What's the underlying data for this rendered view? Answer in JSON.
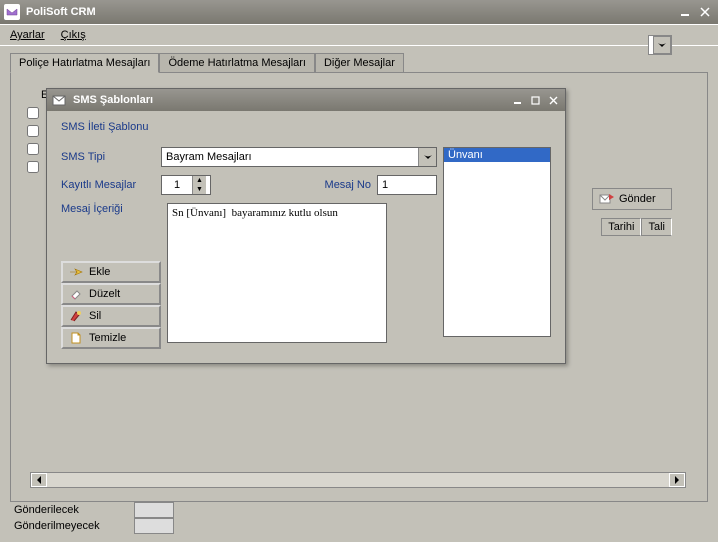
{
  "window": {
    "title": "PoliSoft CRM"
  },
  "menu": {
    "ayarlar": "Ayarlar",
    "cikis": "Çıkış"
  },
  "tabs": {
    "police": "Poliçe Hatırlatma Mesajları",
    "odeme": "Ödeme Hatırlatma Mesajları",
    "diger": "Diğer Mesajlar"
  },
  "bg": {
    "c1": "",
    "c2": "E"
  },
  "gonder": "Gönder",
  "table": {
    "col1": "Tarihi",
    "col2": "Tali"
  },
  "status": {
    "gonderilecek": "Gönderilecek",
    "gonderilmeyecek": "Gönderilmeyecek"
  },
  "dialog": {
    "title": "SMS Şablonları",
    "group": "SMS İleti Şablonu",
    "sms_tipi_label": "SMS Tipi",
    "sms_tipi_value": "Bayram Mesajları",
    "kayitli_label": "Kayıtlı Mesajlar",
    "kayitli_value": "1",
    "mesaj_no_label": "Mesaj No",
    "mesaj_no_value": "1",
    "mesaj_icerigi_label": "Mesaj İçeriği",
    "mesaj_icerigi_value": "Sn [Ünvanı]  bayaramınız kutlu olsun",
    "listbox_item": "Ünvanı",
    "buttons": {
      "ekle": "Ekle",
      "duzelt": "Düzelt",
      "sil": "Sil",
      "temizle": "Temizle"
    }
  }
}
